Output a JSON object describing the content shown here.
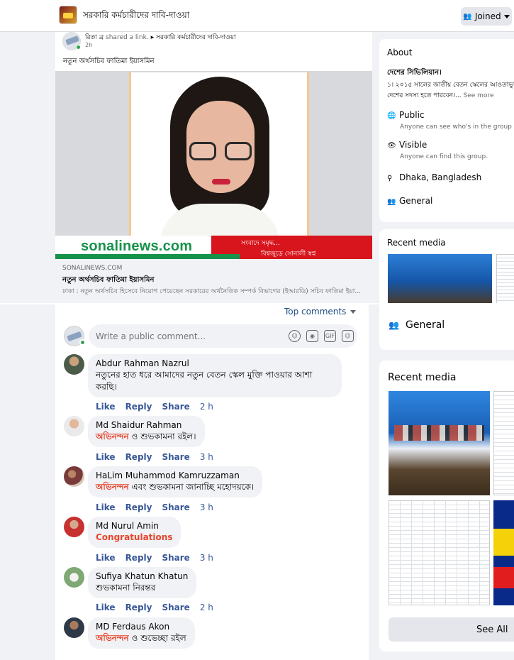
{
  "topbar": {
    "group_name": "সরকারি কর্মচারীদের দাবি-দাওয়া",
    "joined_label": "Joined"
  },
  "post": {
    "author": "রিতা ব্র",
    "shared_text": "shared a link.",
    "target_group": "সরকারি কর্মচারীদের দাবি-দাওয়া",
    "time": "2h",
    "text": "নতুন অর্থসচিব ফাতিমা ইয়াসমিন",
    "image_brand": "sonalinews.com",
    "image_tagline_1": "সংবাদে সমৃদ্ধ...",
    "image_tagline_2": "বিশ্বজুড়ে সোনালী স্বপ্ন",
    "link_domain": "SONALINEWS.COM",
    "link_title": "নতুন অর্থসচিব ফাতিমা ইয়াসমিন",
    "link_description": "ঢাকা : নতুন অর্থসচিব হিসেবে নিয়োগ পেয়েছেন সরকারের অর্থনৈতিক সম্পর্ক বিভাগের (ইআরডি) সচিব ফাতিমা ইয়া..."
  },
  "about": {
    "title": "About",
    "rules_title": "দেশের সিভিলিয়ান।",
    "rules_line_1": "১। ২০১৫ সালের জাতীয় বেতন স্কেলের আওতাভুক্ত",
    "rules_line_2": "দেশের সদস্য হতে পারবেন।...",
    "see_more": "See more",
    "privacy": "Public",
    "privacy_desc": "Anyone can see who's in the group and",
    "visibility": "Visible",
    "visibility_desc": "Anyone can find this group.",
    "location": "Dhaka, Bangladesh",
    "category": "General"
  },
  "recent_media_small": {
    "title": "Recent media"
  },
  "comments": {
    "sort_label": "Top comments",
    "write_placeholder": "Write a public comment...",
    "write_icons": [
      "smile-icon",
      "camera-icon",
      "gif-icon",
      "sticker-icon"
    ],
    "actions": {
      "like": "Like",
      "reply": "Reply",
      "share": "Share"
    },
    "items": [
      {
        "name": "Abdur Rahman Nazrul",
        "text_1": "নতুনের হাত ধরে আমাদের নতুন বেতন স্কেল মুক্তি পাওয়ার আশা",
        "text_2": "করছি।",
        "time": "2 h"
      },
      {
        "name": "Md Shaidur Rahman",
        "highlight": "অভিনন্দন",
        "text_1": " ও শুভকামনা রইল।",
        "time": "3 h"
      },
      {
        "name": "HaLim Muhammod Kamruzzaman",
        "highlight": "অভিনন্দন",
        "text_1": " এবং শুভকামনা জানাচ্ছি মহোদয়কে।",
        "time": "3 h"
      },
      {
        "name": "Md Nurul Amin",
        "highlight": "Congratulations",
        "time": "3 h"
      },
      {
        "name": "Sufiya Khatun Khatun",
        "text_1": "শুভকামনা নিরন্তর",
        "time": "2 h"
      },
      {
        "name": "MD Ferdaus Akon",
        "highlight": "অভিনন্দন",
        "text_1": " ও শুভেচ্ছা রইল",
        "time": "2 h"
      }
    ]
  },
  "sidebar_lower": {
    "general_label": "General",
    "recent_media_title": "Recent media",
    "see_all_label": "See All"
  },
  "colors": {
    "link_blue": "#385898",
    "highlight_red": "#e8452c",
    "brand_green": "#17924a",
    "brand_red": "#d8141c"
  }
}
